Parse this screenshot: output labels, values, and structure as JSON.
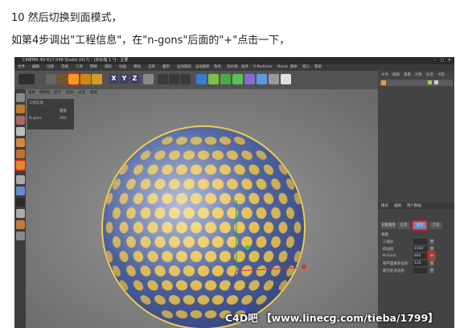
{
  "caption": {
    "line1": "10 然后切换到面模式，",
    "line2": "如第4步调出\"工程信息\"，在\"n-gons\"后面的\"+\"点击一下，"
  },
  "app": {
    "title": "CINEMA 4D R17.048 Studio (R17) - [未标题 1 *] - 主要",
    "menu": [
      "文件",
      "编辑",
      "创建",
      "选择",
      "工具",
      "网格",
      "捕捉",
      "动画",
      "模拟",
      "渲染",
      "雕刻",
      "运动跟踪",
      "运动图形",
      "角色",
      "流水线",
      "插件",
      "X-Particles",
      "Naval",
      "脚本",
      "窗口",
      "帮助"
    ],
    "viewport_menu": [
      "查看",
      "摄像机",
      "显示",
      "选项",
      "过滤",
      "面板"
    ],
    "viewport_info": {
      "title": "工程信息",
      "col_header": "面数",
      "row_label": "N-gons",
      "row_value": "492"
    },
    "toolbar": {
      "axis_x": "X",
      "axis_y": "Y",
      "axis_z": "Z"
    },
    "right_panel": {
      "object_tabs": [
        "文件",
        "编辑",
        "查看",
        "对象",
        "标签",
        "书签"
      ],
      "attr_top_tabs": [
        "模式",
        "编辑",
        "用户数据"
      ],
      "attr_tabs": [
        "对象属性",
        "信息",
        "视窗",
        "工程"
      ],
      "active_attr_tab": "视窗",
      "section_title": "视图",
      "rows": [
        {
          "label": "三角形",
          "value": ""
        },
        {
          "label": "四边形",
          "value": "1560"
        },
        {
          "label": "N-Gons",
          "value": "492"
        },
        {
          "label": "每平面要多边形",
          "value": "120"
        },
        {
          "label": "面对此多边形",
          "value": ""
        }
      ],
      "plus_symbol": "+"
    },
    "accent": "#e02020",
    "face_color": "#f2c94c"
  },
  "watermark": "C4D吧 【www.linecg.com/tieba/1799】"
}
